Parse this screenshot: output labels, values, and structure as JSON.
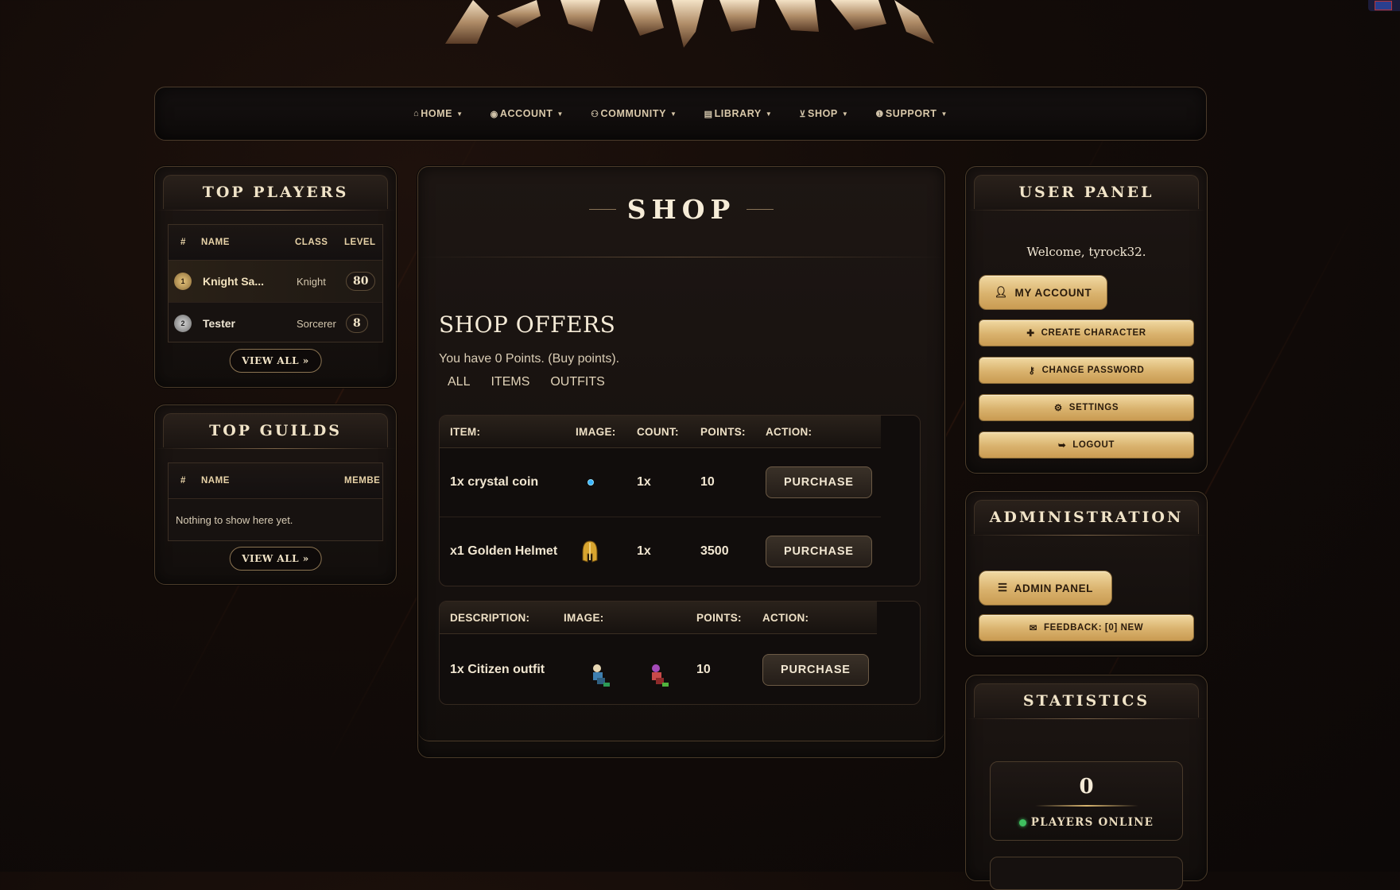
{
  "nav": [
    {
      "label": "HOME",
      "icon": "home-icon"
    },
    {
      "label": "ACCOUNT",
      "icon": "account-icon"
    },
    {
      "label": "COMMUNITY",
      "icon": "community-icon"
    },
    {
      "label": "LIBRARY",
      "icon": "library-icon"
    },
    {
      "label": "SHOP",
      "icon": "shop-cart-icon"
    },
    {
      "label": "SUPPORT",
      "icon": "support-icon"
    }
  ],
  "top_players": {
    "title": "TOP PLAYERS",
    "headers": {
      "rank": "#",
      "name": "NAME",
      "class": "CLASS",
      "level": "LEVEL"
    },
    "rows": [
      {
        "rank": "1",
        "name": "Knight Sa...",
        "class": "Knight",
        "level": "80"
      },
      {
        "rank": "2",
        "name": "Tester",
        "class": "Sorcerer",
        "level": "8"
      }
    ],
    "view_all": "VIEW ALL »"
  },
  "top_guilds": {
    "title": "TOP GUILDS",
    "headers": {
      "rank": "#",
      "name": "NAME",
      "members": "MEMBE"
    },
    "empty": "Nothing to show here yet.",
    "view_all": "VIEW ALL »"
  },
  "shop": {
    "title": "SHOP",
    "offers_title": "SHOP OFFERS",
    "points_text": "You have 0 Points. (Buy points).",
    "filters": [
      "ALL",
      "ITEMS",
      "OUTFITS"
    ],
    "items_headers": {
      "item": "ITEM:",
      "image": "IMAGE:",
      "count": "COUNT:",
      "points": "POINTS:",
      "action": "ACTION:"
    },
    "items": [
      {
        "name": "1x crystal coin",
        "count": "1x",
        "points": "10",
        "action": "PURCHASE",
        "image": "crystal-coin-icon"
      },
      {
        "name": "x1 Golden Helmet",
        "count": "1x",
        "points": "3500",
        "action": "PURCHASE",
        "image": "golden-helmet-icon"
      }
    ],
    "outfit_headers": {
      "description": "DESCRIPTION:",
      "image": "IMAGE:",
      "points": "POINTS:",
      "action": "ACTION:"
    },
    "outfits": [
      {
        "name": "1x Citizen outfit",
        "points": "10",
        "action": "PURCHASE"
      }
    ]
  },
  "user_panel": {
    "title": "USER PANEL",
    "welcome": "Welcome, tyrock32.",
    "my_account": "MY ACCOUNT",
    "buttons": [
      "CREATE CHARACTER",
      "CHANGE PASSWORD",
      "SETTINGS",
      "LOGOUT"
    ]
  },
  "administration": {
    "title": "ADMINISTRATION",
    "admin_panel": "ADMIN PANEL",
    "feedback": "FEEDBACK: [0] NEW"
  },
  "statistics": {
    "title": "STATISTICS",
    "players_online": "0",
    "players_online_label": "PLAYERS ONLINE"
  },
  "colors": {
    "accent_gold": "#d9b26d",
    "online_green": "#3fbf5f",
    "background": "#120b08"
  }
}
